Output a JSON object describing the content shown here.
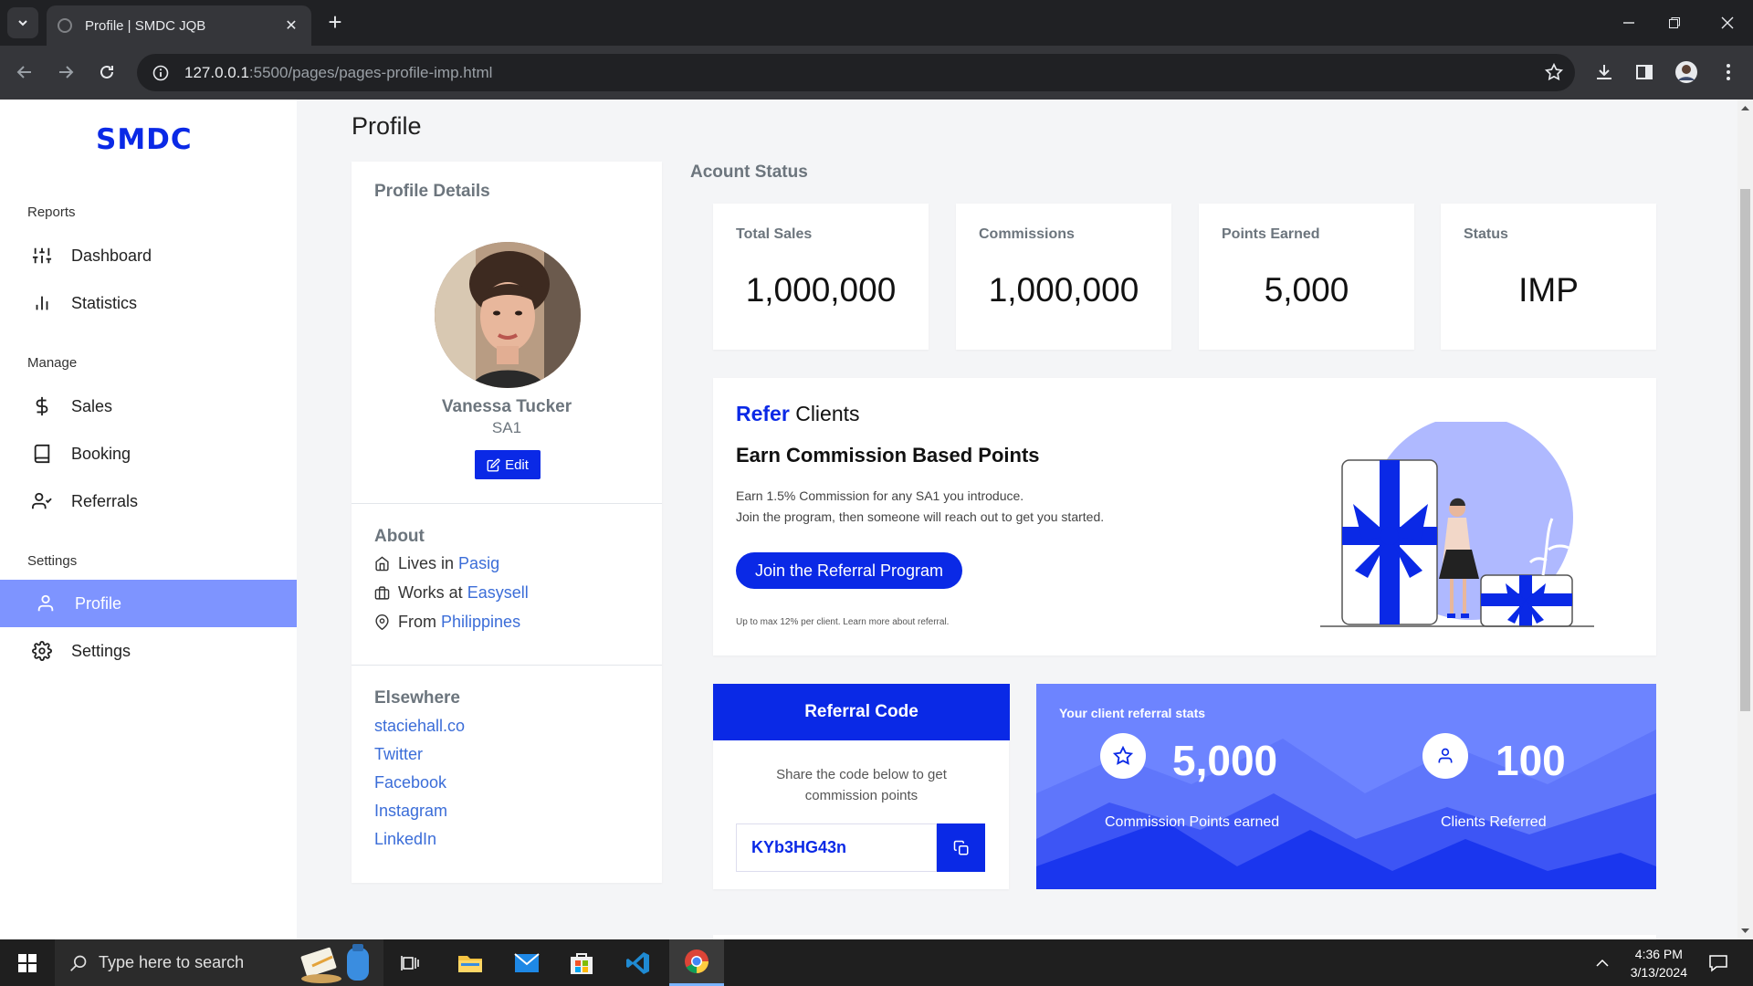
{
  "browser": {
    "tab_title": "Profile | SMDC JQB",
    "url_host": "127.0.0.1",
    "url_rest": ":5500/pages/pages-profile-imp.html"
  },
  "sidebar": {
    "logo": "SMDC",
    "sections": [
      {
        "title": "Reports",
        "items": [
          {
            "label": "Dashboard",
            "icon": "sliders-icon"
          },
          {
            "label": "Statistics",
            "icon": "bar-chart-icon"
          }
        ]
      },
      {
        "title": "Manage",
        "items": [
          {
            "label": "Sales",
            "icon": "dollar-icon"
          },
          {
            "label": "Booking",
            "icon": "book-icon"
          },
          {
            "label": "Referrals",
            "icon": "user-check-icon"
          }
        ]
      },
      {
        "title": "Settings",
        "items": [
          {
            "label": "Profile",
            "icon": "user-icon",
            "active": true
          },
          {
            "label": "Settings",
            "icon": "gear-icon"
          }
        ]
      }
    ]
  },
  "page": {
    "title": "Profile"
  },
  "profile": {
    "section_title": "Profile Details",
    "name": "Vanessa Tucker",
    "role": "SA1",
    "edit_label": "Edit",
    "about_title": "About",
    "about": [
      {
        "prefix": "Lives in",
        "value": "Pasig"
      },
      {
        "prefix": "Works at",
        "value": "Easysell"
      },
      {
        "prefix": "From",
        "value": "Philippines"
      }
    ],
    "elsewhere_title": "Elsewhere",
    "elsewhere": [
      "staciehall.co",
      "Twitter",
      "Facebook",
      "Instagram",
      "LinkedIn"
    ]
  },
  "account": {
    "title": "Acount Status",
    "cards": [
      {
        "label": "Total Sales",
        "value": "1,000,000"
      },
      {
        "label": "Commissions",
        "value": "1,000,000"
      },
      {
        "label": "Points Earned",
        "value": "5,000"
      },
      {
        "label": "Status",
        "value": "IMP"
      }
    ]
  },
  "refer": {
    "heading_accent": "Refer",
    "heading_rest": "Clients",
    "subheading": "Earn Commission Based Points",
    "line1": "Earn 1.5% Commission for any SA1 you introduce.",
    "line2": "Join the program, then someone will reach out to get you started.",
    "button": "Join the Referral Program",
    "footnote": "Up to max 12% per client. Learn more about referral."
  },
  "referral_code": {
    "title": "Referral Code",
    "desc_line1": "Share the code below to get",
    "desc_line2": "commission points",
    "code": "KYb3HG43n"
  },
  "referral_stats": {
    "title": "Your client referral stats",
    "points": "5,000",
    "points_label": "Commission Points earned",
    "clients": "100",
    "clients_label": "Clients Referred"
  },
  "taskbar": {
    "search_placeholder": "Type here to search",
    "time": "4:36 PM",
    "date": "3/13/2024"
  },
  "colors": {
    "accent": "#0a29e6",
    "sidebar_active": "#7e94ff",
    "stats_panel": "#6d84ff"
  }
}
